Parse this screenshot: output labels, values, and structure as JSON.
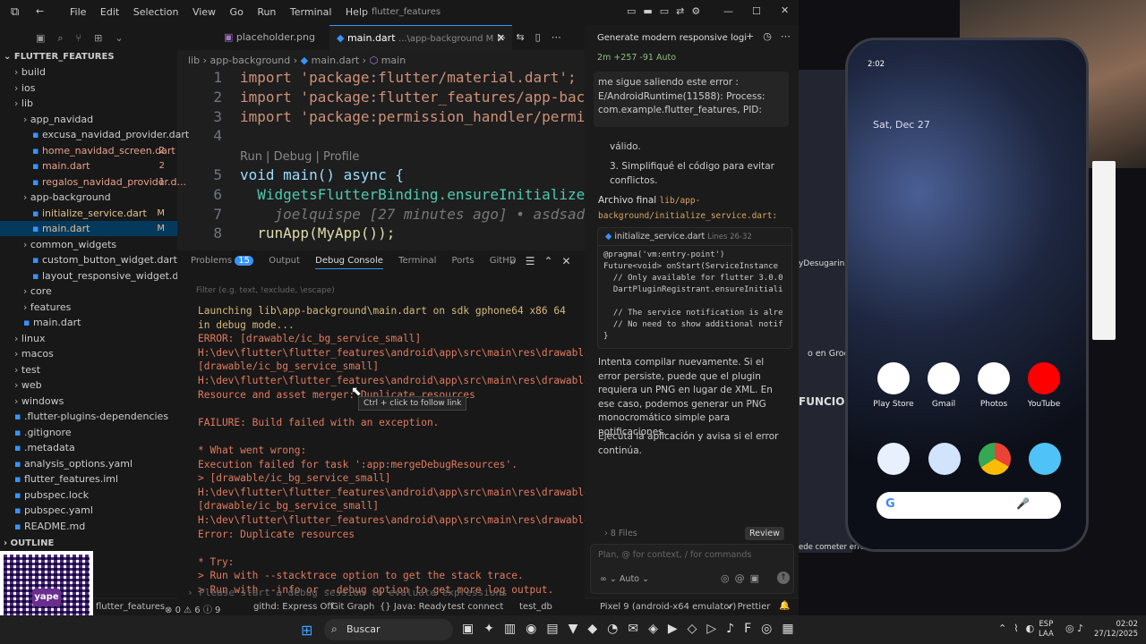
{
  "window": {
    "title": "flutter_features",
    "menu": [
      "File",
      "Edit",
      "Selection",
      "View",
      "Go",
      "Run",
      "Terminal",
      "Help"
    ]
  },
  "explorer": {
    "root": "FLUTTER_FEATURES",
    "items": [
      {
        "label": "build",
        "indent": 1,
        "folder": true,
        "badge": ""
      },
      {
        "label": "ios",
        "indent": 1,
        "folder": true,
        "badge": ""
      },
      {
        "label": "lib",
        "indent": 1,
        "folder": true,
        "badge": ""
      },
      {
        "label": "app_navidad",
        "indent": 2,
        "folder": true,
        "badge": ""
      },
      {
        "label": "excusa_navidad_provider.dart",
        "indent": 3,
        "folder": false,
        "badge": ""
      },
      {
        "label": "home_navidad_screen.dart",
        "indent": 3,
        "folder": false,
        "badge": "2"
      },
      {
        "label": "main.dart",
        "indent": 3,
        "folder": false,
        "badge": "2"
      },
      {
        "label": "regalos_navidad_provider.d...",
        "indent": 3,
        "folder": false,
        "badge": "1"
      },
      {
        "label": "app-background",
        "indent": 2,
        "folder": true,
        "badge": ""
      },
      {
        "label": "initialize_service.dart",
        "indent": 3,
        "folder": false,
        "badge": "M"
      },
      {
        "label": "main.dart",
        "indent": 3,
        "folder": false,
        "badge": "M"
      },
      {
        "label": "common_widgets",
        "indent": 2,
        "folder": true,
        "badge": ""
      },
      {
        "label": "custom_button_widget.dart",
        "indent": 3,
        "folder": false,
        "badge": ""
      },
      {
        "label": "layout_responsive_widget.dart",
        "indent": 3,
        "folder": false,
        "badge": ""
      },
      {
        "label": "core",
        "indent": 2,
        "folder": true,
        "badge": ""
      },
      {
        "label": "features",
        "indent": 2,
        "folder": true,
        "badge": ""
      },
      {
        "label": "main.dart",
        "indent": 2,
        "folder": false,
        "badge": ""
      },
      {
        "label": "linux",
        "indent": 1,
        "folder": true,
        "badge": ""
      },
      {
        "label": "macos",
        "indent": 1,
        "folder": true,
        "badge": ""
      },
      {
        "label": "test",
        "indent": 1,
        "folder": true,
        "badge": ""
      },
      {
        "label": "web",
        "indent": 1,
        "folder": true,
        "badge": ""
      },
      {
        "label": "windows",
        "indent": 1,
        "folder": true,
        "badge": ""
      },
      {
        "label": ".flutter-plugins-dependencies",
        "indent": 1,
        "folder": false,
        "badge": ""
      },
      {
        "label": ".gitignore",
        "indent": 1,
        "folder": false,
        "badge": ""
      },
      {
        "label": ".metadata",
        "indent": 1,
        "folder": false,
        "badge": ""
      },
      {
        "label": "analysis_options.yaml",
        "indent": 1,
        "folder": false,
        "badge": ""
      },
      {
        "label": "flutter_features.iml",
        "indent": 1,
        "folder": false,
        "badge": ""
      },
      {
        "label": "pubspec.lock",
        "indent": 1,
        "folder": false,
        "badge": ""
      },
      {
        "label": "pubspec.yaml",
        "indent": 1,
        "folder": false,
        "badge": ""
      },
      {
        "label": "README.md",
        "indent": 1,
        "folder": false,
        "badge": ""
      }
    ],
    "outline": "OUTLINE"
  },
  "tabs": [
    {
      "label": "placeholder.png",
      "active": false
    },
    {
      "label": "main.dart",
      "suffix": "...\\app-background M",
      "active": true
    }
  ],
  "breadcrumb": [
    "lib",
    "app-background",
    "main.dart",
    "main"
  ],
  "code": {
    "lines": [
      {
        "num": "1",
        "text": "import 'package:flutter/material.dart';"
      },
      {
        "num": "2",
        "text": "import 'package:flutter_features/app-backg"
      },
      {
        "num": "3",
        "text": "import 'package:permission_handler/permiss"
      },
      {
        "num": "4",
        "text": ""
      },
      {
        "num": "",
        "text": "Run | Debug | Profile"
      },
      {
        "num": "5",
        "text": "void main() async {"
      },
      {
        "num": "6",
        "text": "  WidgetsFlutterBinding.ensureInitialized("
      },
      {
        "num": "7",
        "text": "    joelquispe [27 minutes ago] • asdsad"
      },
      {
        "num": "8",
        "text": "  runApp(MyApp());"
      }
    ]
  },
  "panel": {
    "tabs": [
      "Problems",
      "Output",
      "Debug Console",
      "Terminal",
      "Ports",
      "GitHD"
    ],
    "problems_count": "15",
    "filter_placeholder": "Filter (e.g. text, !exclude, \\escape)",
    "console": [
      {
        "text": "Launching lib\\app-background\\main.dart on sdk gphone64 x86 64 in debug mode...",
        "kind": "info"
      },
      {
        "text": "ERROR: [drawable/ic_bg_service_small] H:\\dev\\flutter\\flutter_features\\android\\app\\src\\main\\res\\drawable\\ic_bg_service_small.png [drawable/ic_bg_service_small] H:\\dev\\flutter\\flutter_features\\android\\app\\src\\main\\res\\drawable\\ic_bg_service_small.xml: Resource and asset merger: Duplicate resources",
        "kind": "err"
      },
      {
        "text": "",
        "kind": "err"
      },
      {
        "text": "FAILURE: Build failed with an exception.",
        "kind": "err"
      },
      {
        "text": "",
        "kind": "err"
      },
      {
        "text": "* What went wrong:",
        "kind": "err"
      },
      {
        "text": "Execution failed for task ':app:mergeDebugResources'.",
        "kind": "err"
      },
      {
        "text": "> [drawable/ic_bg_service_small] H:\\dev\\flutter\\flutter_features\\android\\app\\src\\main\\res\\drawable\\ic_bg_service_small.png  [drawable/ic_bg_service_small] H:\\dev\\flutter\\flutter_features\\android\\app\\src\\main\\res\\drawable\\ic_bg_service_small.xml: Error: Duplicate resources",
        "kind": "err"
      },
      {
        "text": "",
        "kind": "err"
      },
      {
        "text": "* Try:",
        "kind": "err"
      },
      {
        "text": "> Run with --stacktrace option to get the stack trace.",
        "kind": "err"
      },
      {
        "text": "> Run with --info or --debug option to get more log output.",
        "kind": "err"
      }
    ],
    "tooltip": "Ctrl + click to follow link",
    "input_placeholder": "Please start a debug session to evaluate expressions"
  },
  "chat": {
    "title": "Generate modern responsive logi",
    "meta": "2m  +257 -91  Auto",
    "user_message": "me sigue saliendo este error : E/AndroidRuntime(11588): Process: com.example.flutter_features, PID:",
    "partial": "válido.",
    "list_item": "3. Simplifiqué el código para evitar conflictos.",
    "final_label": "Archivo final",
    "final_path": "lib/app-background/initialize_service.dart:",
    "code_file": "initialize_service.dart",
    "code_lines_label": "Lines 26-32",
    "code": [
      "@pragma('vm:entry-point')",
      "Future<void> onStart(ServiceInstance",
      "  // Only available for flutter 3.0.0",
      "  DartPluginRegistrant.ensureInitiali",
      "",
      "  // The service notification is alre",
      "  // No need to show additional notif",
      "}"
    ],
    "para1": "Intenta compilar nuevamente. Si el error persiste, puede que el plugin requiera un PNG en lugar de XML. En ese caso, podemos generar un PNG monocromático simple para notificaciones.",
    "para2": "Ejecuta la aplicación y avisa si el error continúa.",
    "files": "8 Files",
    "review": "Review",
    "input_placeholder": "Plan, @ for context, / for commands",
    "mode": "Auto"
  },
  "statusbar": {
    "branch": "flutter_features",
    "errors": "0",
    "warnings": "6",
    "info": "9",
    "githd": "githd: Express Off",
    "gitgraph": "Git Graph",
    "java": "Java: Ready",
    "test_connect": "test connect",
    "test_db": "test_db",
    "device": "Pixel 9 (android-x64 emulator)",
    "prettier": "Prettier"
  },
  "taskbar": {
    "search": "Buscar",
    "lang": "ESP",
    "lang2": "LAA",
    "time": "02:02",
    "date": "27/12/2025"
  },
  "phone": {
    "status_time": "2:02",
    "date": "Sat, Dec 27",
    "apps_row1": [
      "Play Store",
      "Gmail",
      "Photos",
      "YouTube"
    ]
  },
  "right_fragments": {
    "groovy": "o en Groovy.",
    "funciona": "FUNCIONA",
    "desgarin": "yDesugarin",
    "cometer": "ede cometer errores."
  },
  "qr": {
    "brand": "yape"
  },
  "colors": {
    "accent": "#3794ff",
    "error": "#e07a5f",
    "git_modified": "#e2c08d",
    "keyword": "#569cd6",
    "string": "#ce9178",
    "function": "#dcdcaa",
    "type": "#4ec9b0"
  }
}
